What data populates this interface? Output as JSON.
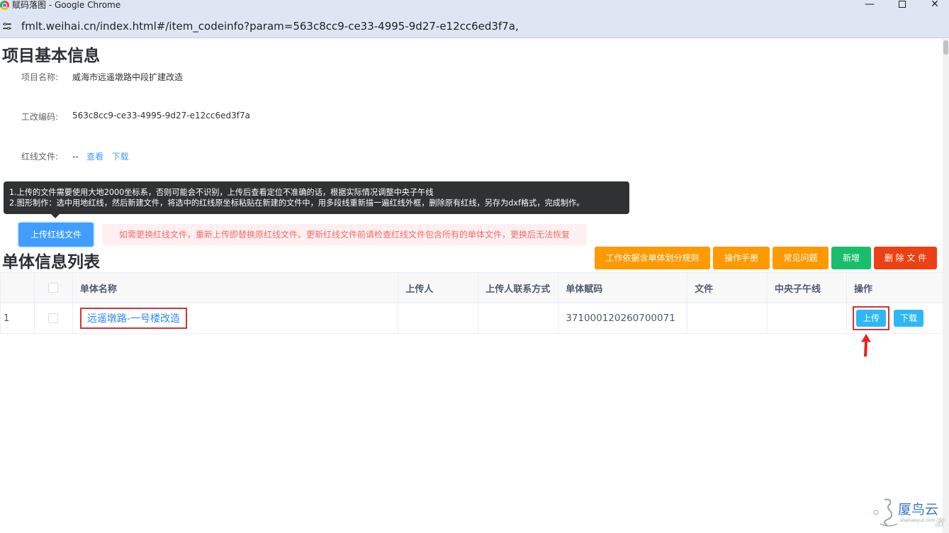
{
  "window": {
    "title": "赋码落图 - Google Chrome",
    "minimize": "—",
    "close": "✕"
  },
  "browser": {
    "url": "fmlt.weihai.cn/index.html#/item_codeinfo?param=563c8cc9-ce33-4995-9d27-e12cc6ed3f7a,"
  },
  "project_info": {
    "heading": "项目基本信息",
    "name_label": "项目名称:",
    "name_value": "威海市远遥墩路中段扩建改造",
    "code_label": "工改编码:",
    "code_value": "563c8cc9-ce33-4995-9d27-e12cc6ed3f7a",
    "redline_label": "红线文件:",
    "redline_value": "--",
    "view_link": "查看",
    "download_link": "下载"
  },
  "tooltip": {
    "line1": "1.上传的文件需要使用大地2000坐标系，否则可能会不识别，上传后查看定位不准确的话，根据实际情况调整中央子午线",
    "line2": "2.图形制作：选中用地红线，然后新建文件，将选中的红线原坐标粘贴在新建的文件中，用多段线重新描一遍红线外框，删除原有红线，另存为dxf格式，完成制作。"
  },
  "upload_redline_button": "上传红线文件",
  "warning": "如需更换红线文件，重新上传即替换原红线文件。更新红线文件前请检查红线文件包含所有的单体文件，更换后无法恢复",
  "unit_list": {
    "heading": "单体信息列表",
    "toolbar": {
      "rules": "工作依据含单体划分规则",
      "manual": "操作手册",
      "faq": "常见问题",
      "add": "新增",
      "delete_file": "删 除 文 件"
    },
    "columns": [
      "",
      "",
      "单体名称",
      "上传人",
      "上传人联系方式",
      "单体赋码",
      "文件",
      "中央子午线",
      "操作"
    ],
    "rows": [
      {
        "index": "1",
        "name": "远遥墩路-一号楼改造",
        "uploader": "",
        "contact": "",
        "code": "371000120260700071",
        "file": "",
        "meridian": "",
        "upload_btn": "上传",
        "download_btn": "下载"
      }
    ]
  },
  "watermark": {
    "brand": "厦鸟云",
    "site": "shaniaoyun.com",
    "corner": "激"
  },
  "colors": {
    "primary": "#409eff",
    "warning_orange": "#ff9900",
    "success_green": "#19be6b",
    "danger_red": "#ed4014",
    "highlight_red": "#d03537"
  }
}
